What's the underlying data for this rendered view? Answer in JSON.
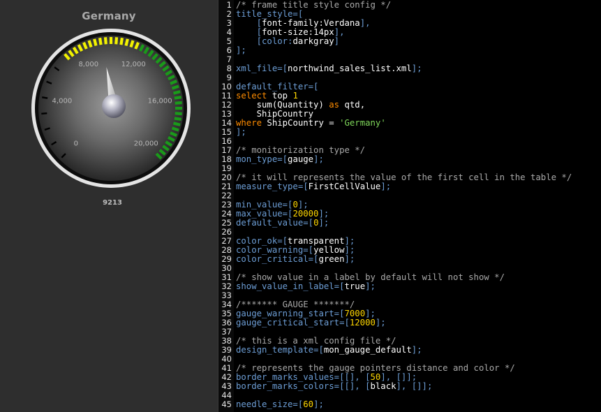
{
  "gauge": {
    "title": "Germany",
    "value_label": "9213",
    "value": 9213,
    "min": 0,
    "max": 20000,
    "warning_start": 7000,
    "critical_start": 12000,
    "warning_color": "#f2f200",
    "critical_color": "#1a9a1a",
    "tick_labels": [
      "0",
      "4,000",
      "8,000",
      "12,000",
      "16,000",
      "20,000"
    ]
  },
  "editor": {
    "lines": [
      [
        [
          "com",
          "/* frame title style config */"
        ]
      ],
      [
        [
          "br",
          "title_style=["
        ]
      ],
      [
        [
          "br",
          "    ["
        ],
        [
          "val",
          "font-family:Verdana"
        ],
        [
          "br",
          "],"
        ]
      ],
      [
        [
          "br",
          "    ["
        ],
        [
          "val",
          "font-size:14px"
        ],
        [
          "br",
          "],"
        ]
      ],
      [
        [
          "br",
          "    [color:"
        ],
        [
          "val",
          "darkgray"
        ],
        [
          "br",
          "]"
        ]
      ],
      [
        [
          "br",
          "];"
        ]
      ],
      [],
      [
        [
          "br",
          "xml_file=["
        ],
        [
          "val",
          "northwind_sales_list.xml"
        ],
        [
          "br",
          "];"
        ]
      ],
      [],
      [
        [
          "br",
          "default_filter=["
        ]
      ],
      [
        [
          "kw",
          "select"
        ],
        [
          "val",
          " top "
        ],
        [
          "num",
          "1"
        ]
      ],
      [
        [
          "val",
          "    sum(Quantity) "
        ],
        [
          "kw",
          "as"
        ],
        [
          "val",
          " qtd,"
        ]
      ],
      [
        [
          "val",
          "    ShipCountry"
        ]
      ],
      [
        [
          "kw",
          "where"
        ],
        [
          "val",
          " ShipCountry = "
        ],
        [
          "str",
          "'Germany'"
        ]
      ],
      [
        [
          "br",
          "];"
        ]
      ],
      [],
      [
        [
          "com",
          "/* monitorization type */"
        ]
      ],
      [
        [
          "br",
          "mon_type=["
        ],
        [
          "val",
          "gauge"
        ],
        [
          "br",
          "];"
        ]
      ],
      [],
      [
        [
          "com",
          "/* it will represents the value of the first cell in the table */"
        ]
      ],
      [
        [
          "br",
          "measure_type=["
        ],
        [
          "val",
          "FirstCellValue"
        ],
        [
          "br",
          "];"
        ]
      ],
      [],
      [
        [
          "br",
          "min_value=["
        ],
        [
          "num",
          "0"
        ],
        [
          "br",
          "];"
        ]
      ],
      [
        [
          "br",
          "max_value=["
        ],
        [
          "num",
          "20000"
        ],
        [
          "br",
          "];"
        ]
      ],
      [
        [
          "br",
          "default_value=["
        ],
        [
          "num",
          "0"
        ],
        [
          "br",
          "];"
        ]
      ],
      [],
      [
        [
          "br",
          "color_ok=["
        ],
        [
          "val",
          "transparent"
        ],
        [
          "br",
          "];"
        ]
      ],
      [
        [
          "br",
          "color_warning=["
        ],
        [
          "val",
          "yellow"
        ],
        [
          "br",
          "];"
        ]
      ],
      [
        [
          "br",
          "color_critical=["
        ],
        [
          "val",
          "green"
        ],
        [
          "br",
          "];"
        ]
      ],
      [],
      [
        [
          "com",
          "/* show value in a label by default will not show */"
        ]
      ],
      [
        [
          "br",
          "show_value_in_label=["
        ],
        [
          "val",
          "true"
        ],
        [
          "br",
          "];"
        ]
      ],
      [],
      [
        [
          "com",
          "/******* GAUGE *******/"
        ]
      ],
      [
        [
          "br",
          "gauge_warning_start=["
        ],
        [
          "num",
          "7000"
        ],
        [
          "br",
          "];"
        ]
      ],
      [
        [
          "br",
          "gauge_critical_start=["
        ],
        [
          "num",
          "12000"
        ],
        [
          "br",
          "];"
        ]
      ],
      [],
      [
        [
          "com",
          "/* this is a xml config file */"
        ]
      ],
      [
        [
          "br",
          "design_template=["
        ],
        [
          "val",
          "mon_gauge_default"
        ],
        [
          "br",
          "];"
        ]
      ],
      [],
      [
        [
          "com",
          "/* represents the gauge pointers distance and color */"
        ]
      ],
      [
        [
          "br",
          "border_marks_values=[[], ["
        ],
        [
          "num",
          "50"
        ],
        [
          "br",
          "], []];"
        ]
      ],
      [
        [
          "br",
          "border_marks_colors=[[], ["
        ],
        [
          "val",
          "black"
        ],
        [
          "br",
          "], []];"
        ]
      ],
      [],
      [
        [
          "br",
          "needle_size=["
        ],
        [
          "num",
          "60"
        ],
        [
          "br",
          "];"
        ]
      ]
    ]
  }
}
